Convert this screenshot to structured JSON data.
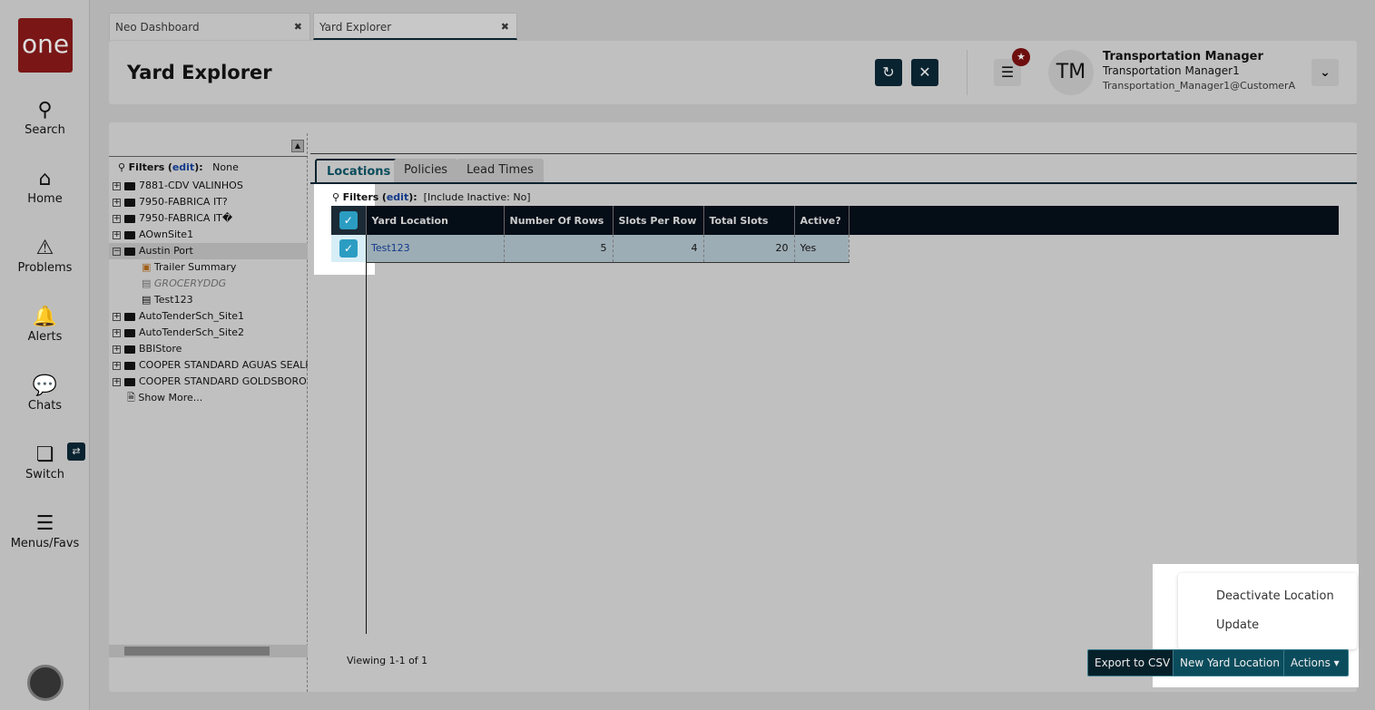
{
  "nav": {
    "logo": "one",
    "items": [
      {
        "label": "Search",
        "icon": "search-icon"
      },
      {
        "label": "Home",
        "icon": "home-icon"
      },
      {
        "label": "Problems",
        "icon": "warning-icon"
      },
      {
        "label": "Alerts",
        "icon": "bell-icon"
      },
      {
        "label": "Chats",
        "icon": "chat-icon"
      },
      {
        "label": "Switch",
        "icon": "switch-icon"
      },
      {
        "label": "Menus/Favs",
        "icon": "menu-icon"
      }
    ]
  },
  "tabs": [
    {
      "label": "Neo Dashboard"
    },
    {
      "label": "Yard Explorer"
    }
  ],
  "header": {
    "title": "Yard Explorer",
    "user_initials": "TM",
    "user_role": "Transportation Manager",
    "user_name": "Transportation Manager1",
    "user_org": "Transportation_Manager1@CustomerA"
  },
  "tree": {
    "filters_label": "Filters",
    "edit": "edit",
    "filters_value": "None",
    "nodes": [
      "7881-CDV VALINHOS",
      "7950-FABRICA IT?",
      "7950-FABRICA IT�",
      "AOwnSite1",
      "Austin Port"
    ],
    "children": [
      "Trailer Summary",
      "GROCERYDDG",
      "Test123"
    ],
    "nodes2": [
      "AutoTenderSch_Site1",
      "AutoTenderSch_Site2",
      "BBIStore",
      "COOPER STANDARD AGUAS SEALING",
      "COOPER STANDARD GOLDSBORO"
    ],
    "show_more": "Show More..."
  },
  "panel": {
    "tabs": [
      "Locations",
      "Policies",
      "Lead Times"
    ],
    "filters_label": "Filters",
    "edit": "edit",
    "filters_value": "[Include Inactive: No]",
    "columns": [
      "Yard Location",
      "Number Of Rows",
      "Slots Per Row",
      "Total Slots",
      "Active?"
    ],
    "rows": [
      [
        "Test123",
        "5",
        "4",
        "20",
        "Yes"
      ]
    ],
    "viewing": "Viewing 1-1 of 1"
  },
  "buttons": {
    "export": "Export to CSV",
    "new": "New Yard Location",
    "actions": "Actions"
  },
  "menu": [
    "Deactivate Location",
    "Update"
  ]
}
